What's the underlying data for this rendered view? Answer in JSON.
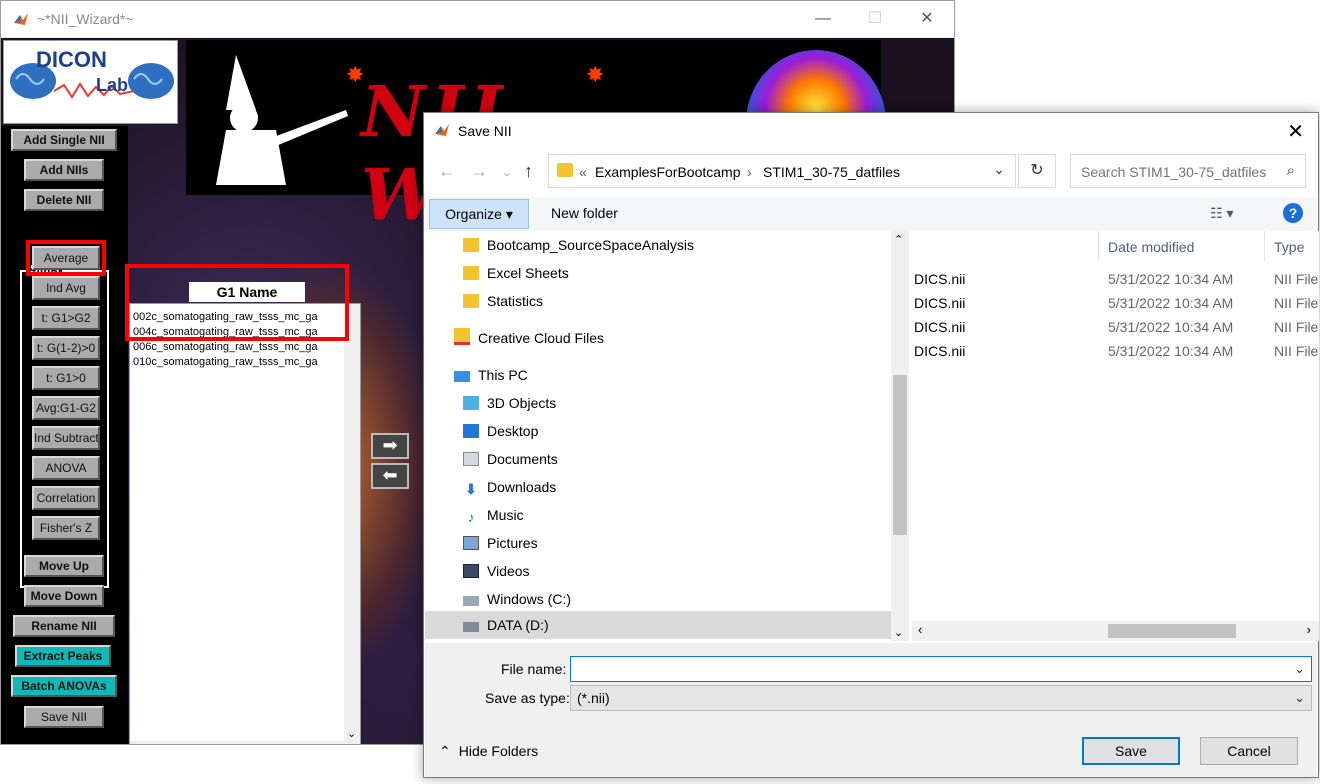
{
  "wizard": {
    "title": "~*NII_Wizard*~",
    "logo_line1": "DICON",
    "logo_line2": "Lab",
    "banner_text": "NII WIZARD",
    "buttons": {
      "add_single": "Add Single NII",
      "add_niis": "Add NIIs",
      "delete": "Delete NII",
      "move_up": "Move Up",
      "move_down": "Move Down",
      "rename": "Rename NII",
      "extract_peaks": "Extract Peaks",
      "batch_anovas": "Batch ANOVAs",
      "save": "Save NII"
    },
    "stats": {
      "label": "Stats",
      "buttons": [
        "Average",
        "Ind Avg",
        "t: G1>G2",
        "t: G(1-2)>0",
        "t: G1>0",
        "Avg:G1-G2",
        "Ind Subtract",
        "ANOVA",
        "Correlation",
        "Fisher's Z"
      ]
    },
    "g1_label": "G1 Name",
    "g1_items": [
      "002c_somatogating_raw_tsss_mc_ga",
      "004c_somatogating_raw_tsss_mc_ga",
      "006c_somatogating_raw_tsss_mc_ga",
      "010c_somatogating_raw_tsss_mc_ga"
    ],
    "arrow_right": "➡",
    "arrow_left": "⬅"
  },
  "dialog": {
    "title": "Save NII",
    "breadcrumb": [
      "«",
      "ExamplesForBootcamp",
      "›",
      "STIM1_30-75_datfiles"
    ],
    "search_placeholder": "Search STIM1_30-75_datfiles",
    "organize": "Organize ▾",
    "new_folder": "New folder",
    "nav_items": [
      {
        "label": "Bootcamp_SourceSpaceAnalysis",
        "icon": "folder-icon"
      },
      {
        "label": "Excel Sheets",
        "icon": "folder-icon"
      },
      {
        "label": "Statistics",
        "icon": "folder-icon"
      },
      {
        "label": "Creative Cloud Files",
        "icon": "creative-cloud-icon"
      },
      {
        "label": "This PC",
        "icon": "this-pc-icon"
      },
      {
        "label": "3D Objects",
        "icon": "3d-objects-icon"
      },
      {
        "label": "Desktop",
        "icon": "desktop-icon"
      },
      {
        "label": "Documents",
        "icon": "documents-icon"
      },
      {
        "label": "Downloads",
        "icon": "downloads-icon"
      },
      {
        "label": "Music",
        "icon": "music-icon"
      },
      {
        "label": "Pictures",
        "icon": "pictures-icon"
      },
      {
        "label": "Videos",
        "icon": "videos-icon"
      },
      {
        "label": "Windows (C:)",
        "icon": "drive-c-icon"
      },
      {
        "label": "DATA (D:)",
        "icon": "drive-d-icon"
      }
    ],
    "columns": {
      "date": "Date modified",
      "type": "Type"
    },
    "files": [
      {
        "name": "DICS.nii",
        "date": "5/31/2022 10:34 AM",
        "type": "NII File"
      },
      {
        "name": "DICS.nii",
        "date": "5/31/2022 10:34 AM",
        "type": "NII File"
      },
      {
        "name": "DICS.nii",
        "date": "5/31/2022 10:34 AM",
        "type": "NII File"
      },
      {
        "name": "DICS.nii",
        "date": "5/31/2022 10:34 AM",
        "type": "NII File"
      }
    ],
    "file_name_label": "File name:",
    "file_name_value": "",
    "save_type_label": "Save as type:",
    "save_type_value": "(*.nii)",
    "hide_folders": "Hide Folders",
    "save_button": "Save",
    "cancel_button": "Cancel"
  },
  "colors": {
    "highlight_red": "#ff0000",
    "teal": "#11b8b8",
    "accent_blue": "#0078d7"
  }
}
